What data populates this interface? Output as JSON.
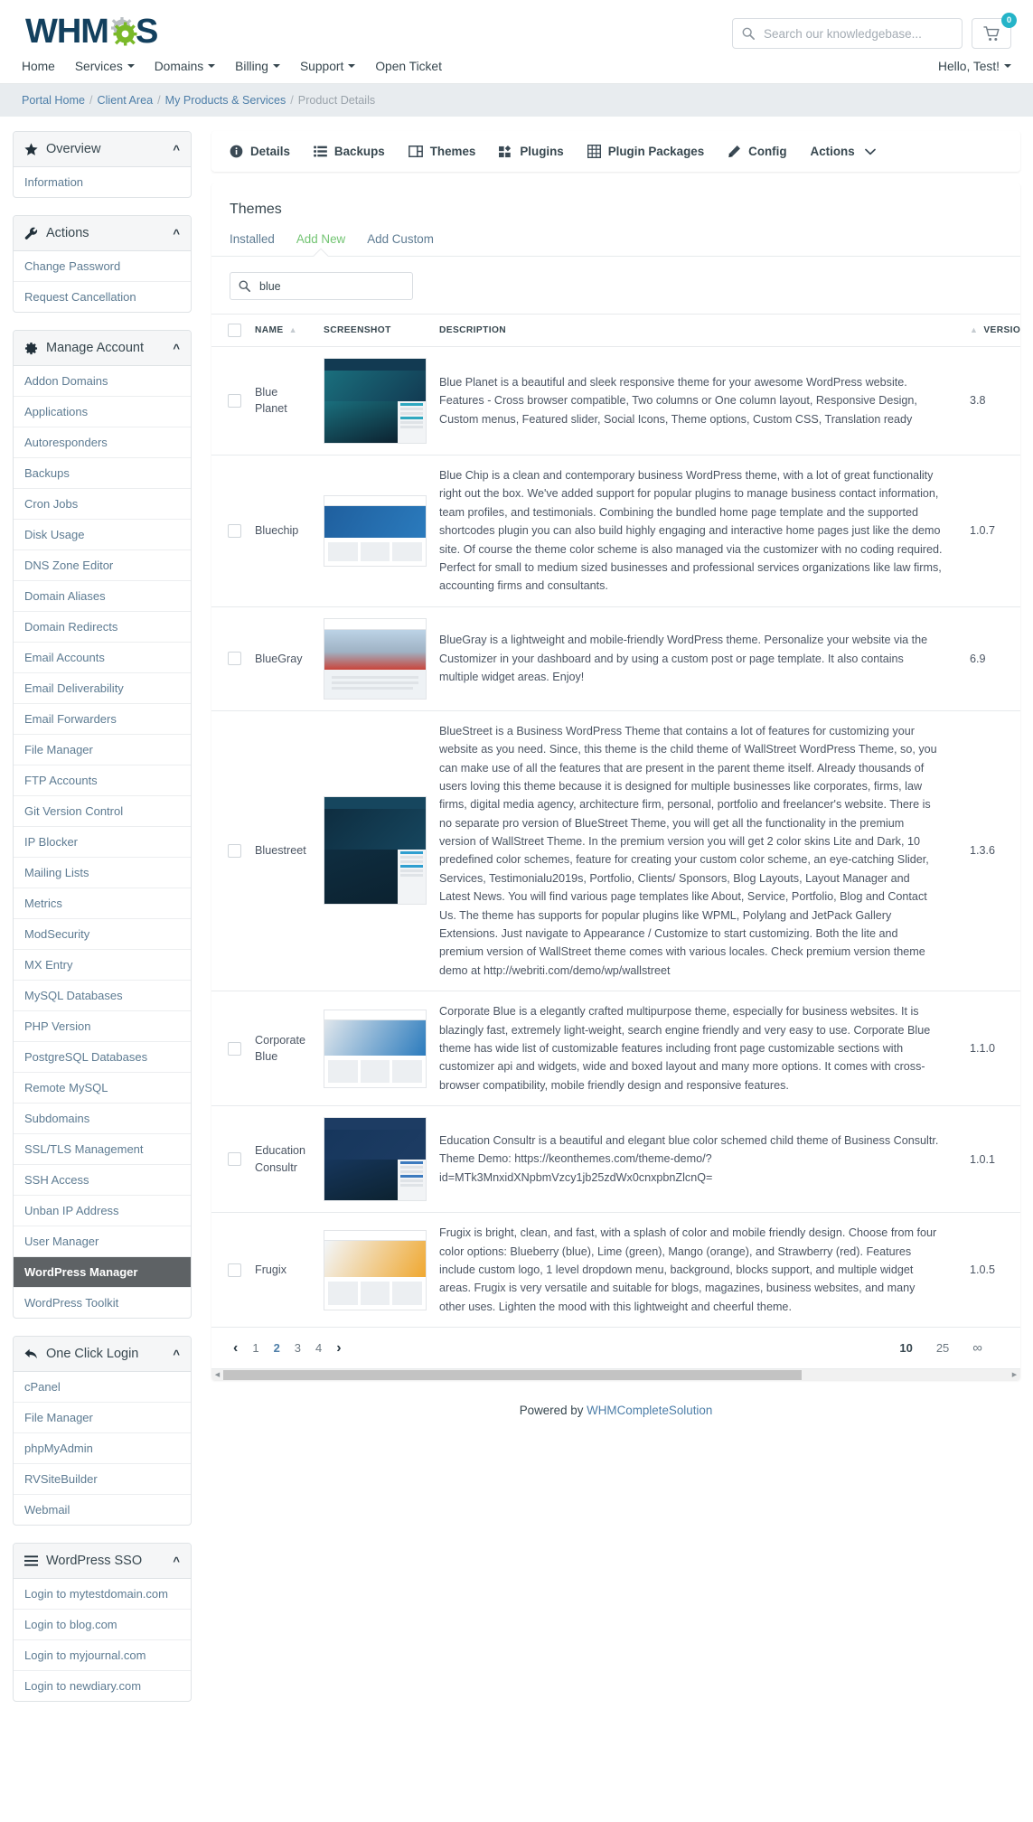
{
  "brand": {
    "name": "WHMCS",
    "logo_dark": "#13405e",
    "logo_green": "#7ab929"
  },
  "header": {
    "search_placeholder": "Search our knowledgebase...",
    "search_value": "",
    "cart_count": "0",
    "greeting": "Hello, Test!"
  },
  "nav": {
    "items": [
      {
        "label": "Home",
        "caret": false
      },
      {
        "label": "Services",
        "caret": true
      },
      {
        "label": "Domains",
        "caret": true
      },
      {
        "label": "Billing",
        "caret": true
      },
      {
        "label": "Support",
        "caret": true
      },
      {
        "label": "Open Ticket",
        "caret": false
      }
    ]
  },
  "breadcrumb": {
    "items": [
      "Portal Home",
      "Client Area",
      "My Products & Services",
      "Product Details"
    ]
  },
  "sidebar": {
    "panels": [
      {
        "title": "Overview",
        "icon": "star-icon",
        "items": [
          {
            "label": "Information",
            "active": false
          }
        ]
      },
      {
        "title": "Actions",
        "icon": "wrench-icon",
        "items": [
          {
            "label": "Change Password",
            "active": false
          },
          {
            "label": "Request Cancellation",
            "active": false
          }
        ]
      },
      {
        "title": "Manage Account",
        "icon": "gear-icon",
        "items": [
          {
            "label": "Addon Domains",
            "active": false
          },
          {
            "label": "Applications",
            "active": false
          },
          {
            "label": "Autoresponders",
            "active": false
          },
          {
            "label": "Backups",
            "active": false
          },
          {
            "label": "Cron Jobs",
            "active": false
          },
          {
            "label": "Disk Usage",
            "active": false
          },
          {
            "label": "DNS Zone Editor",
            "active": false
          },
          {
            "label": "Domain Aliases",
            "active": false
          },
          {
            "label": "Domain Redirects",
            "active": false
          },
          {
            "label": "Email Accounts",
            "active": false
          },
          {
            "label": "Email Deliverability",
            "active": false
          },
          {
            "label": "Email Forwarders",
            "active": false
          },
          {
            "label": "File Manager",
            "active": false
          },
          {
            "label": "FTP Accounts",
            "active": false
          },
          {
            "label": "Git Version Control",
            "active": false
          },
          {
            "label": "IP Blocker",
            "active": false
          },
          {
            "label": "Mailing Lists",
            "active": false
          },
          {
            "label": "Metrics",
            "active": false
          },
          {
            "label": "ModSecurity",
            "active": false
          },
          {
            "label": "MX Entry",
            "active": false
          },
          {
            "label": "MySQL Databases",
            "active": false
          },
          {
            "label": "PHP Version",
            "active": false
          },
          {
            "label": "PostgreSQL Databases",
            "active": false
          },
          {
            "label": "Remote MySQL",
            "active": false
          },
          {
            "label": "Subdomains",
            "active": false
          },
          {
            "label": "SSL/TLS Management",
            "active": false
          },
          {
            "label": "SSH Access",
            "active": false
          },
          {
            "label": "Unban IP Address",
            "active": false
          },
          {
            "label": "User Manager",
            "active": false
          },
          {
            "label": "WordPress Manager",
            "active": true
          },
          {
            "label": "WordPress Toolkit",
            "active": false
          }
        ]
      },
      {
        "title": "One Click Login",
        "icon": "reply-arrow-icon",
        "items": [
          {
            "label": "cPanel",
            "active": false
          },
          {
            "label": "File Manager",
            "active": false
          },
          {
            "label": "phpMyAdmin",
            "active": false
          },
          {
            "label": "RVSiteBuilder",
            "active": false
          },
          {
            "label": "Webmail",
            "active": false
          }
        ]
      },
      {
        "title": "WordPress SSO",
        "icon": "hamburger-icon",
        "items": [
          {
            "label": "Login to mytestdomain.com",
            "active": false
          },
          {
            "label": "Login to blog.com",
            "active": false
          },
          {
            "label": "Login to myjournal.com",
            "active": false
          },
          {
            "label": "Login to newdiary.com",
            "active": false
          }
        ]
      }
    ]
  },
  "product_tabs": [
    {
      "label": "Details",
      "icon": "info-circle-icon"
    },
    {
      "label": "Backups",
      "icon": "list-icon"
    },
    {
      "label": "Themes",
      "icon": "window-icon"
    },
    {
      "label": "Plugins",
      "icon": "puzzle-icon"
    },
    {
      "label": "Plugin Packages",
      "icon": "grid-icon"
    },
    {
      "label": "Config",
      "icon": "pencil-icon"
    },
    {
      "label": "Actions",
      "icon": "chevron-down-icon"
    }
  ],
  "themes": {
    "title": "Themes",
    "subtabs": [
      {
        "label": "Installed",
        "active": false
      },
      {
        "label": "Add New",
        "active": true
      },
      {
        "label": "Add Custom",
        "active": false
      }
    ],
    "search_value": "blue",
    "search_placeholder": "",
    "columns": [
      "NAME",
      "SCREENSHOT",
      "DESCRIPTION",
      "VERSION"
    ],
    "rows": [
      {
        "name": "Blue Planet",
        "version": "3.8",
        "description": "Blue Planet is a beautiful and sleek responsive theme for your awesome WordPress website. Features - Cross browser compatible, Two columns or One column layout, Responsive Design, Custom menus, Featured slider, Social Icons, Theme options, Custom CSS, Translation ready",
        "shot": {
          "header": "#123a52",
          "hero": "#1a6f7d",
          "accent": "#2fa8c0",
          "style": "dark"
        }
      },
      {
        "name": "Bluechip",
        "version": "1.0.7",
        "description": "Blue Chip is a clean and contemporary business WordPress theme, with a lot of great functionality right out the box. We've added support for popular plugins to manage business contact information, team profiles, and testimonials. Combining the bundled home page template and the supported shortcodes plugin you can also build highly engaging and interactive home pages just like the demo site. Of course the theme color scheme is also managed via the customizer with no coding required. Perfect for small to medium sized businesses and professional services organizations like law firms, accounting firms and consultants.",
        "shot": {
          "header": "#ffffff",
          "hero": "#1f5f9e",
          "accent": "#2b7bbd",
          "style": "light"
        }
      },
      {
        "name": "BlueGray",
        "version": "6.9",
        "description": "BlueGray is a lightweight and mobile-friendly WordPress theme. Personalize your website via the Customizer in your dashboard and by using a custom post or page template. It also contains multiple widget areas. Enjoy!",
        "shot": {
          "header": "#ffffff",
          "hero": "#9fb2c4",
          "accent": "#c9443a",
          "style": "photo"
        }
      },
      {
        "name": "Bluestreet",
        "version": "1.3.6",
        "description": "BlueStreet is a Business WordPress Theme that contains a lot of features for customizing your website as you need. Since, this theme is the child theme of WallStreet WordPress Theme, so, you can make use of all the features that are present in the parent theme itself. Already thousands of users loving this theme because it is designed for multiple businesses like corporates, firms, law firms, digital media agency, architecture firm, personal, portfolio and freelancer's website. There is no separate pro version of BlueStreet Theme, you will get all the functionality in the premium version of WallStreet Theme. In the premium version you will get 2 color skins Lite and Dark, 10 predefined color schemes, feature for creating your custom color scheme, an eye-catching Slider, Services, Testimonialu2019s, Portfolio, Clients/ Sponsors, Blog Layouts, Layout Manager and Latest News. You will find various page templates like About, Service, Portfolio, Blog and Contact Us. The theme has supports for popular plugins like WPML, Polylang and JetPack Gallery Extensions. Just navigate to Appearance / Customize to start customizing. Both the lite and premium version of WallStreet theme comes with various locales. Check premium version theme demo at http://webriti.com/demo/wp/wallstreet",
        "shot": {
          "header": "#16465e",
          "hero": "#0e2d40",
          "accent": "#2f9fd0",
          "style": "dark"
        }
      },
      {
        "name": "Corporate Blue",
        "version": "1.1.0",
        "description": "Corporate Blue is a elegantly crafted multipurpose theme, especially for business websites. It is blazingly fast, extremely light-weight, search engine friendly and very easy to use. Corporate Blue theme has wide list of customizable features including front page customizable sections with customizer api and widgets, wide and boxed layout and many more options. It comes with cross-browser compatibility, mobile friendly design and responsive features.",
        "shot": {
          "header": "#ffffff",
          "hero": "#dfe6ec",
          "accent": "#2b7bbd",
          "style": "light"
        }
      },
      {
        "name": "Education Consultr",
        "version": "1.0.1",
        "description": "Education Consultr is a beautiful and elegant blue color schemed child theme of Business Consultr. Theme Demo: https://keonthemes.com/theme-demo/?id=MTk3MnxidXNpbmVzcy1jb25zdWx0cnxpbnZlcnQ=",
        "shot": {
          "header": "#1d3c63",
          "hero": "#16365c",
          "accent": "#3d7bbf",
          "style": "dark"
        }
      },
      {
        "name": "Frugix",
        "version": "1.0.5",
        "description": "Frugix is bright, clean, and fast, with a splash of color and mobile friendly design. Choose from four color options: Blueberry (blue), Lime (green), Mango (orange), and Strawberry (red). Features include custom logo, 1 level dropdown menu, background, blocks support, and multiple widget areas. Frugix is very versatile and suitable for blogs, magazines, business websites, and many other uses. Lighten the mood with this lightweight and cheerful theme.",
        "shot": {
          "header": "#ffffff",
          "hero": "#f2f6fa",
          "accent": "#f0a830",
          "style": "light"
        }
      }
    ],
    "pagination": {
      "prev": "‹",
      "next": "›",
      "pages": [
        {
          "label": "1",
          "current": false
        },
        {
          "label": "2",
          "current": true
        },
        {
          "label": "3",
          "current": false
        },
        {
          "label": "4",
          "current": false
        }
      ],
      "per_page": [
        {
          "label": "10",
          "current": true
        },
        {
          "label": "25",
          "current": false
        },
        {
          "label": "∞",
          "current": false
        }
      ]
    }
  },
  "footer": {
    "prefix": "Powered by ",
    "link": "WHMCompleteSolution"
  }
}
